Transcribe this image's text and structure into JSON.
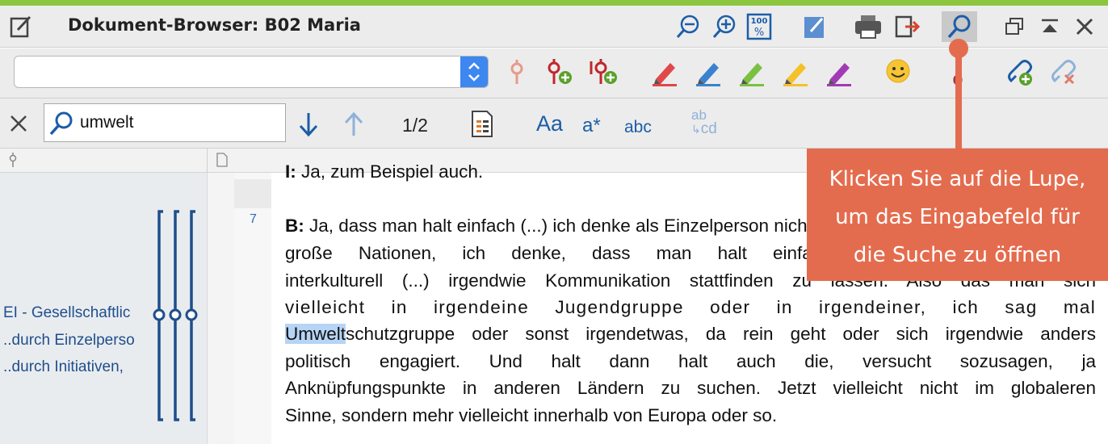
{
  "window": {
    "title": "Dokument-Browser: B02 Maria"
  },
  "titlebar_icons": [
    "zoom-out-icon",
    "zoom-in-icon",
    "zoom-100-icon",
    "edit-mode-icon",
    "print-icon",
    "export-icon",
    "search-icon",
    "window-restore-icon",
    "collapse-icon",
    "close-icon"
  ],
  "code_toolbar": {
    "combo_value": "",
    "icons": [
      "code-icon",
      "new-code-icon",
      "in-vivo-code-icon",
      "highlight-red-icon",
      "highlight-blue-icon",
      "highlight-green-icon",
      "highlight-yellow-icon",
      "highlight-purple-icon",
      "emoticon-icon",
      "link-icon",
      "add-link-icon",
      "remove-link-icon"
    ]
  },
  "search": {
    "query": "umwelt",
    "counter": "1/2",
    "case_label": "Aa",
    "wildcard_label": "a*",
    "whole_word_label": "abc",
    "replace_label_top": "ab",
    "replace_label_bottom": "cd"
  },
  "codes_panel": {
    "items": [
      "EI - Gesellschaftlic",
      "..durch Einzelperso",
      "..durch Initiativen,"
    ]
  },
  "document": {
    "line_number": "7",
    "prev_line_speaker": "I:",
    "prev_line_text": " Ja, zum Beispiel auch.",
    "speaker": "B:",
    "lines": [
      " Ja, dass man halt einfach (...) ich denke als Einzelperson nicht, dass man da jetzt",
      "große Nationen, ich denke, dass man halt einfach die Möglichkeit hat da",
      "interkulturell (...) irgendwie Kommunikation stattfinden zu lassen. Also das man sich",
      "vielleicht in irgendeine Jugendgruppe oder in irgendeiner, ich sag mal",
      "schutzgruppe oder sonst irgendetwas, da rein geht oder sich irgendwie anders",
      "politisch engagiert. Und halt dann halt auch die, versucht sozusagen, ja",
      "Anknüpfungspunkte in anderen Ländern zu suchen. Jetzt vielleicht nicht im globaleren",
      "Sinne, sondern mehr vielleicht innerhalb von Europa oder so."
    ],
    "highlight_word": "Umwelt"
  },
  "callout": {
    "line1": "Klicken Sie auf die Lupe,",
    "line2": "um das Eingabefeld für",
    "line3": "die Suche zu öffnen"
  },
  "colors": {
    "accent": "#8cc63f",
    "callout": "#e46c4e",
    "highlight": "#b6d4f6",
    "icon_blue": "#1c5da8"
  }
}
